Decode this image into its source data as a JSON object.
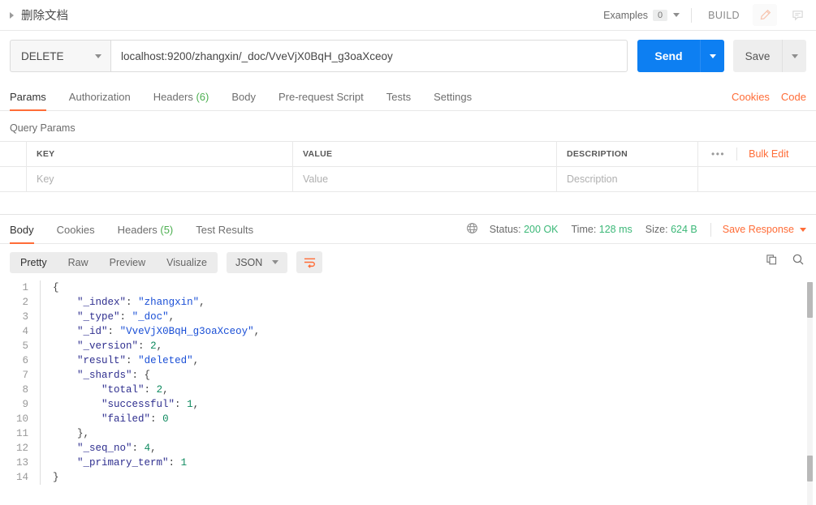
{
  "topbar": {
    "request_title": "删除文档",
    "examples_label": "Examples",
    "examples_count": "0",
    "build_label": "BUILD",
    "edit_icon": "pencil-icon",
    "comment_icon": "comment-icon"
  },
  "urlbar": {
    "method": "DELETE",
    "url": "localhost:9200/zhangxin/_doc/VveVjX0BqH_g3oaXceoy",
    "send_label": "Send",
    "save_label": "Save"
  },
  "request_tabs": {
    "items": [
      {
        "label": "Params",
        "count": "",
        "active": true
      },
      {
        "label": "Authorization",
        "count": "",
        "active": false
      },
      {
        "label": "Headers",
        "count": "(6)",
        "active": false
      },
      {
        "label": "Body",
        "count": "",
        "active": false
      },
      {
        "label": "Pre-request Script",
        "count": "",
        "active": false
      },
      {
        "label": "Tests",
        "count": "",
        "active": false
      },
      {
        "label": "Settings",
        "count": "",
        "active": false
      }
    ],
    "cookies_label": "Cookies",
    "code_label": "Code"
  },
  "query_params": {
    "section_title": "Query Params",
    "columns": [
      "KEY",
      "VALUE",
      "DESCRIPTION"
    ],
    "dots_label": "•••",
    "bulk_edit_label": "Bulk Edit",
    "rows": [
      {
        "key": "Key",
        "value": "Value",
        "description": "Description"
      }
    ]
  },
  "response_tabs": {
    "items": [
      {
        "label": "Body",
        "count": "",
        "active": true
      },
      {
        "label": "Cookies",
        "count": "",
        "active": false
      },
      {
        "label": "Headers",
        "count": "(5)",
        "active": false
      },
      {
        "label": "Test Results",
        "count": "",
        "active": false
      }
    ],
    "globe_icon": "globe-icon",
    "status_label": "Status:",
    "status_value": "200 OK",
    "time_label": "Time:",
    "time_value": "128 ms",
    "size_label": "Size:",
    "size_value": "624 B",
    "save_response_label": "Save Response"
  },
  "body_toolbar": {
    "view_modes": [
      {
        "label": "Pretty",
        "active": true
      },
      {
        "label": "Raw",
        "active": false
      },
      {
        "label": "Preview",
        "active": false
      },
      {
        "label": "Visualize",
        "active": false
      }
    ],
    "format": "JSON",
    "wrap_icon": "word-wrap-icon",
    "copy_icon": "copy-icon",
    "search_icon": "search-icon"
  },
  "response_body": {
    "language": "json",
    "lines": [
      {
        "n": "1",
        "text": "{"
      },
      {
        "n": "2",
        "text": "    \"_index\": \"zhangxin\","
      },
      {
        "n": "3",
        "text": "    \"_type\": \"_doc\","
      },
      {
        "n": "4",
        "text": "    \"_id\": \"VveVjX0BqH_g3oaXceoy\","
      },
      {
        "n": "5",
        "text": "    \"_version\": 2,"
      },
      {
        "n": "6",
        "text": "    \"result\": \"deleted\","
      },
      {
        "n": "7",
        "text": "    \"_shards\": {"
      },
      {
        "n": "8",
        "text": "        \"total\": 2,"
      },
      {
        "n": "9",
        "text": "        \"successful\": 1,"
      },
      {
        "n": "10",
        "text": "        \"failed\": 0"
      },
      {
        "n": "11",
        "text": "    },"
      },
      {
        "n": "12",
        "text": "    \"_seq_no\": 4,"
      },
      {
        "n": "13",
        "text": "    \"_primary_term\": 1"
      },
      {
        "n": "14",
        "text": "}"
      }
    ],
    "parsed": {
      "_index": "zhangxin",
      "_type": "_doc",
      "_id": "VveVjX0BqH_g3oaXceoy",
      "_version": 2,
      "result": "deleted",
      "_shards": {
        "total": 2,
        "successful": 1,
        "failed": 0
      },
      "_seq_no": 4,
      "_primary_term": 1
    }
  },
  "colors": {
    "accent": "#ff6c37",
    "send": "#0d7ff2",
    "status_green": "#3cb878",
    "count_green": "#4caf50"
  }
}
